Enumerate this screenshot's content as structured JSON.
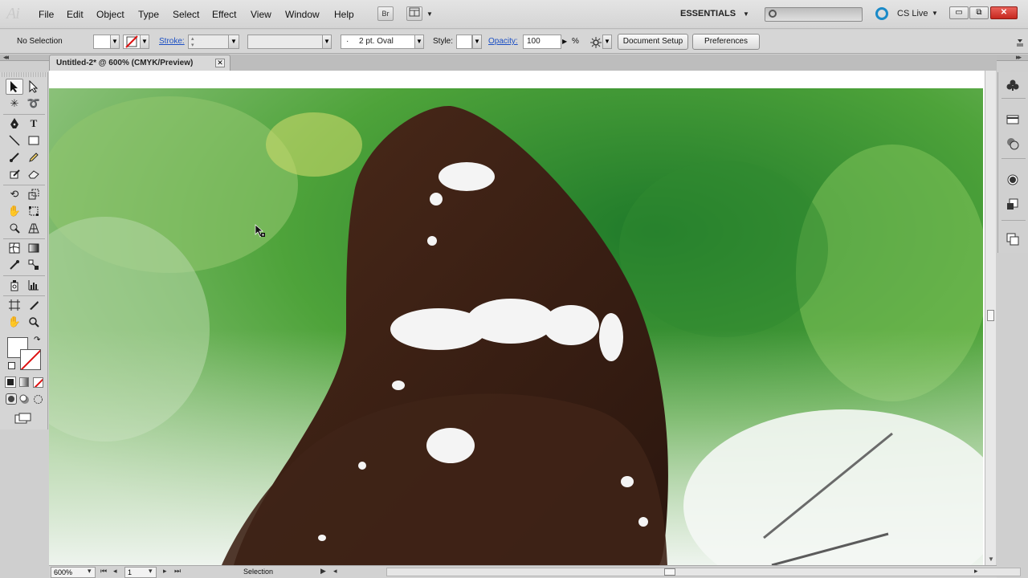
{
  "app": {
    "logo": "Ai"
  },
  "menu": [
    "File",
    "Edit",
    "Object",
    "Type",
    "Select",
    "Effect",
    "View",
    "Window",
    "Help"
  ],
  "menubar_right": {
    "bridge_label": "Br",
    "workspace": "ESSENTIALS",
    "search_placeholder": "",
    "cslive": "CS Live",
    "window_buttons": {
      "minimize": "▭",
      "restore": "⧉",
      "close": "✕"
    }
  },
  "controlbar": {
    "selection": "No Selection",
    "stroke_label": "Stroke:",
    "stroke_weight": "",
    "brush": "2 pt. Oval",
    "brush_prefix": "·",
    "style_label": "Style:",
    "opacity_label": "Opacity:",
    "opacity_value": "100",
    "opacity_unit": "%",
    "document_setup": "Document Setup",
    "preferences": "Preferences"
  },
  "document": {
    "tab_title": "Untitled-2* @ 600% (CMYK/Preview)",
    "tab_close": "✕"
  },
  "statusbar": {
    "zoom": "600%",
    "artboard": "1",
    "status_text": "Selection",
    "nav_first": "⏮",
    "nav_prev": "◂",
    "nav_next": "▸",
    "nav_last": "⏭"
  },
  "colors": {
    "accent_link": "#1b4fc4",
    "close_button": "#c6281f",
    "cslive_ring": "#1a8ac8",
    "artwork_wing": "#3a2015",
    "artwork_bg": "#4a9a3a"
  }
}
